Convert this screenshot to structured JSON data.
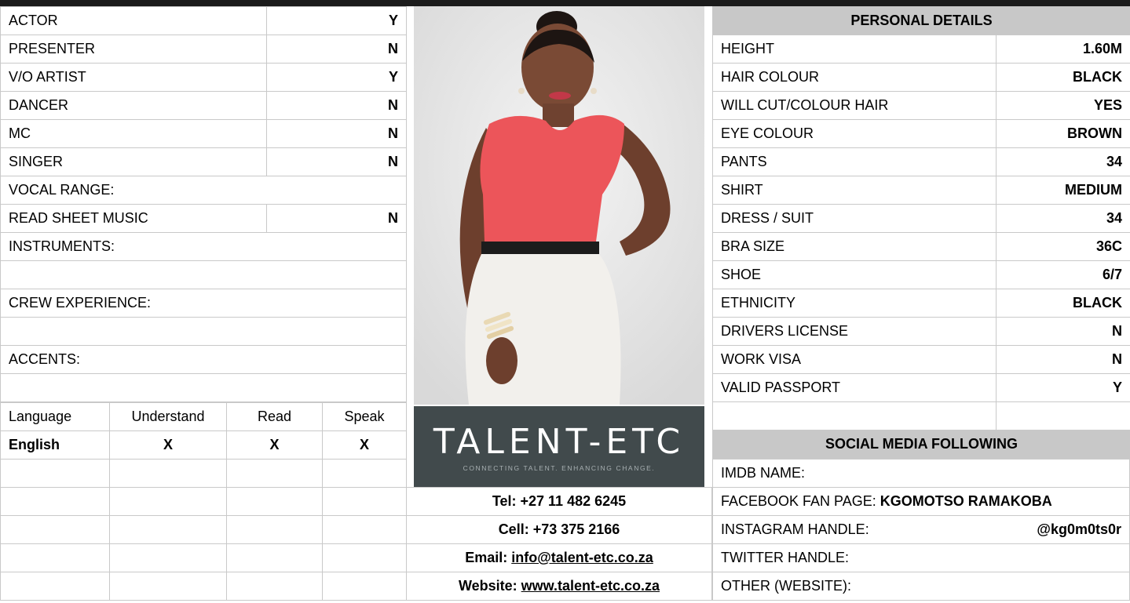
{
  "skills": [
    {
      "label": "ACTOR",
      "value": "Y"
    },
    {
      "label": "PRESENTER",
      "value": "N"
    },
    {
      "label": "V/O ARTIST",
      "value": "Y"
    },
    {
      "label": "DANCER",
      "value": "N"
    },
    {
      "label": "MC",
      "value": "N"
    },
    {
      "label": "SINGER",
      "value": "N"
    }
  ],
  "vocal_range_label": "VOCAL RANGE:",
  "read_sheet_music": {
    "label": "READ SHEET MUSIC",
    "value": "N"
  },
  "instruments_label": "INSTRUMENTS:",
  "crew_experience_label": "CREW EXPERIENCE:",
  "accents_label": "ACCENTS:",
  "languages": {
    "headers": [
      "Language",
      "Understand",
      "Read",
      "Speak"
    ],
    "rows": [
      [
        "English",
        "X",
        "X",
        "X"
      ]
    ]
  },
  "brand": {
    "name": "TALENT-ETC",
    "tagline": "CONNECTING TALENT. ENHANCING CHANGE."
  },
  "contacts": {
    "tel": "Tel: +27 11 482 6245",
    "cell": "Cell: +73 375 2166",
    "email_label": "Email: ",
    "email": "info@talent-etc.co.za",
    "website_label": "Website: ",
    "website": "www.talent-etc.co.za"
  },
  "personal_details": {
    "title": "PERSONAL DETAILS",
    "rows": [
      {
        "label": "HEIGHT",
        "value": "1.60M"
      },
      {
        "label": "HAIR COLOUR",
        "value": "BLACK"
      },
      {
        "label": "WILL CUT/COLOUR HAIR",
        "value": "YES"
      },
      {
        "label": "EYE COLOUR",
        "value": "BROWN"
      },
      {
        "label": "PANTS",
        "value": "34"
      },
      {
        "label": "SHIRT",
        "value": "MEDIUM"
      },
      {
        "label": "DRESS / SUIT",
        "value": "34"
      },
      {
        "label": "BRA SIZE",
        "value": "36C"
      },
      {
        "label": "SHOE",
        "value": "6/7"
      },
      {
        "label": "ETHNICITY",
        "value": "BLACK"
      },
      {
        "label": "DRIVERS LICENSE",
        "value": "N"
      },
      {
        "label": "WORK VISA",
        "value": "N"
      },
      {
        "label": "VALID PASSPORT",
        "value": "Y"
      }
    ]
  },
  "social_media": {
    "title": "SOCIAL MEDIA FOLLOWING",
    "imdb_label": "IMDB NAME:",
    "facebook_label": "FACEBOOK FAN PAGE: ",
    "facebook_value": "KGOMOTSO RAMAKOBA",
    "instagram_label": "INSTAGRAM HANDLE:",
    "instagram_value": "@kg0m0ts0r",
    "twitter_label": "TWITTER HANDLE:",
    "other_label": "OTHER (WEBSITE):"
  }
}
